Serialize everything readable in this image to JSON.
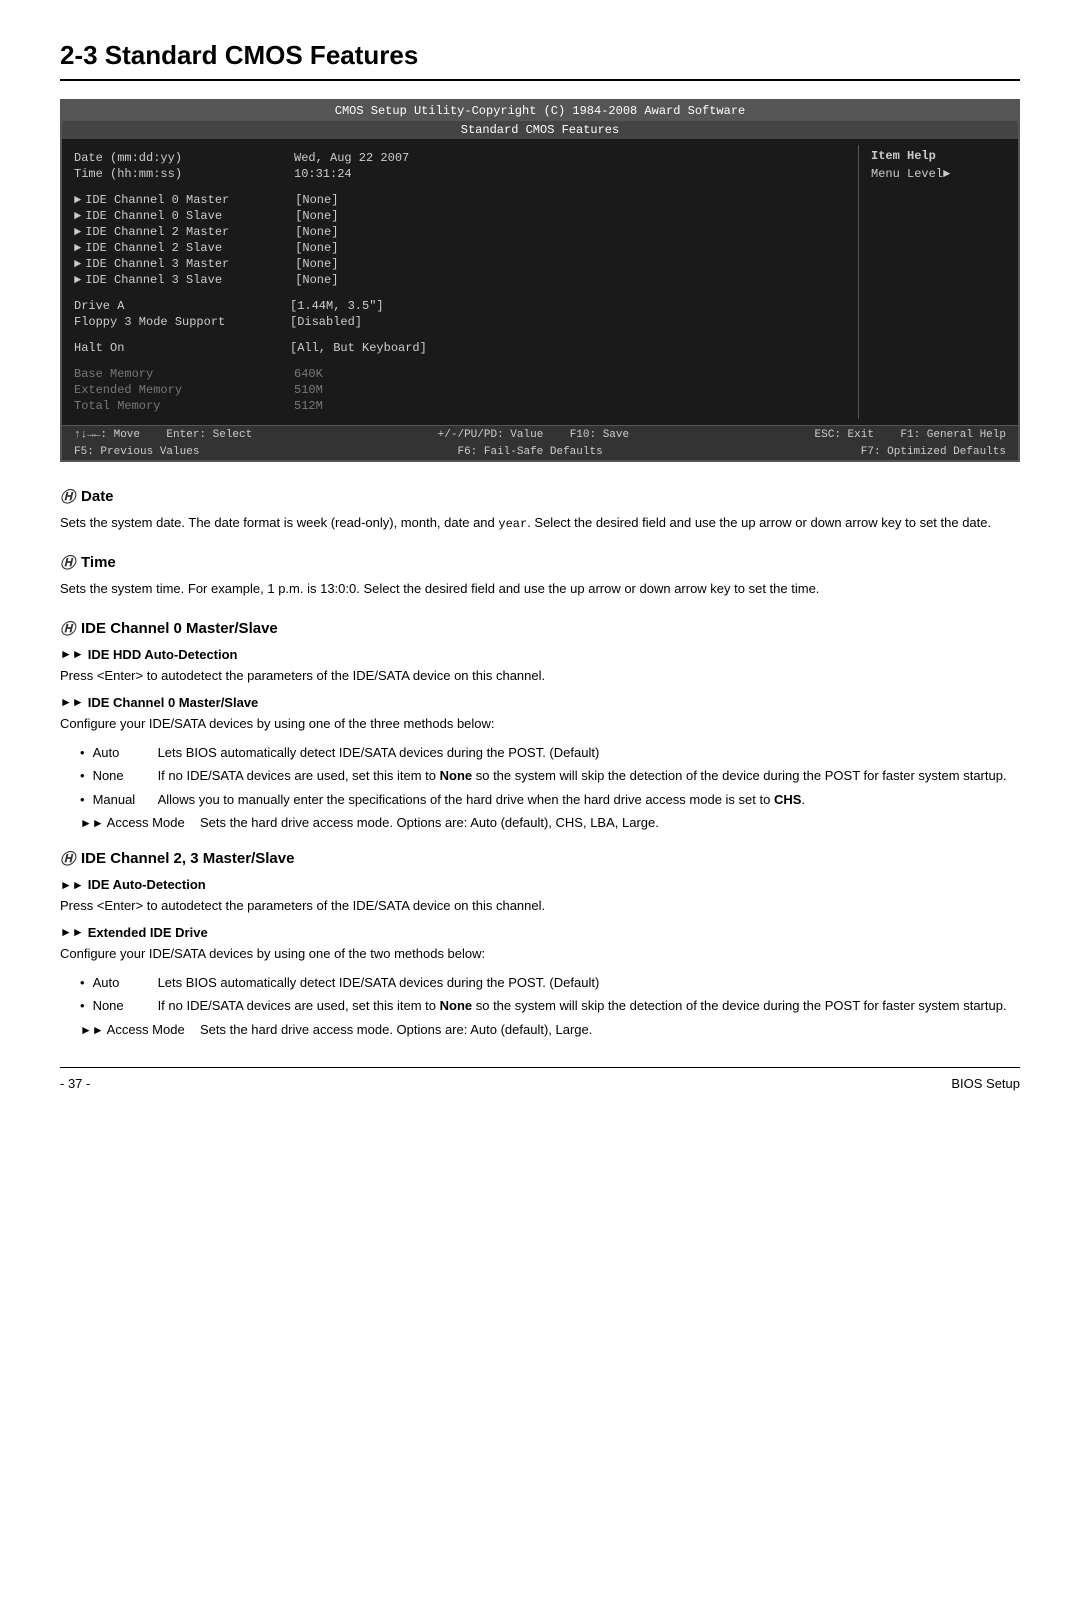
{
  "page": {
    "title": "2-3   Standard CMOS Features",
    "footer_left": "- 37 -",
    "footer_right": "BIOS Setup"
  },
  "bios": {
    "header_line1": "CMOS Setup Utility-Copyright (C) 1984-2008 Award Software",
    "header_line2": "Standard CMOS Features",
    "rows": [
      {
        "label": "Date (mm:dd:yy)",
        "value": "Wed, Aug 22  2007",
        "indent": false,
        "arrow": false,
        "gray": false
      },
      {
        "label": "Time (hh:mm:ss)",
        "value": "10:31:24",
        "indent": false,
        "arrow": false,
        "gray": false
      }
    ],
    "ide_rows": [
      {
        "label": "IDE Channel 0 Master",
        "value": "[None]"
      },
      {
        "label": "IDE Channel 0 Slave",
        "value": "[None]"
      },
      {
        "label": "IDE Channel 2 Master",
        "value": "[None]"
      },
      {
        "label": "IDE Channel 2 Slave",
        "value": "[None]"
      },
      {
        "label": "IDE Channel 3 Master",
        "value": "[None]"
      },
      {
        "label": "IDE Channel 3 Slave",
        "value": "[None]"
      }
    ],
    "drive_rows": [
      {
        "label": "Drive A",
        "value": "[1.44M, 3.5\"]"
      },
      {
        "label": "Floppy 3 Mode Support",
        "value": "[Disabled]"
      }
    ],
    "halt_row": {
      "label": "Halt On",
      "value": "[All, But Keyboard]"
    },
    "mem_rows": [
      {
        "label": "Base Memory",
        "value": "640K"
      },
      {
        "label": "Extended Memory",
        "value": "510M"
      },
      {
        "label": "Total Memory",
        "value": "512M"
      }
    ],
    "item_help_title": "Item Help",
    "item_help_text": "Menu Level►",
    "footer": [
      {
        "left": "↑↓→←: Move    Enter: Select",
        "mid": "+/-/PU/PD: Value    F10: Save",
        "right": "ESC: Exit    F1: General Help"
      },
      {
        "left": "F5: Previous Values",
        "mid": "F6: Fail-Safe Defaults",
        "right": "F7: Optimized Defaults"
      }
    ]
  },
  "sections": [
    {
      "id": "date",
      "heading": "Date",
      "paragraphs": [
        "Sets the system date. The date format is week (read-only), month, date and  year.  Select the desired field and use the up arrow or down arrow key to set the date."
      ],
      "sub_sections": []
    },
    {
      "id": "time",
      "heading": "Time",
      "paragraphs": [
        "Sets the system time. For example, 1 p.m. is 13:0:0. Select the desired field and use the up arrow or down arrow key to set the time."
      ],
      "sub_sections": []
    },
    {
      "id": "ide0",
      "heading": "IDE Channel 0 Master/Slave",
      "paragraphs": [],
      "sub_sections": [
        {
          "title": "IDE HDD Auto-Detection",
          "body": "Press <Enter> to autodetect the parameters of the IDE/SATA device on this channel."
        },
        {
          "title": "IDE Channel 0 Master/Slave",
          "body": "Configure your IDE/SATA devices by using one of the three methods below:",
          "bullets": [
            {
              "term": "Auto",
              "desc": "Lets BIOS automatically detect IDE/SATA devices during the POST. (Default)"
            },
            {
              "term": "None",
              "desc": "If no IDE/SATA devices are used, set this item to None so the system will skip the detection of the device during the POST for faster system startup."
            },
            {
              "term": "Manual",
              "desc": "Allows you to manually enter the specifications of the hard drive when the hard drive access mode is set to CHS."
            }
          ]
        },
        {
          "title": "Access Mode",
          "body": "Sets the hard drive access mode. Options are: Auto (default), CHS, LBA, Large.",
          "is_access": true
        }
      ]
    },
    {
      "id": "ide23",
      "heading": "IDE Channel 2, 3 Master/Slave",
      "paragraphs": [],
      "sub_sections": [
        {
          "title": "IDE Auto-Detection",
          "body": "Press <Enter> to autodetect the parameters of the IDE/SATA device on this channel."
        },
        {
          "title": "Extended IDE Drive",
          "body": "Configure your IDE/SATA devices by using one of the two methods below:",
          "bullets": [
            {
              "term": "Auto",
              "desc": "Lets BIOS automatically detect IDE/SATA devices during the POST. (Default)"
            },
            {
              "term": "None",
              "desc": "If no IDE/SATA devices are used, set this item to None so the system will skip the detection of the device during the POST for faster system startup."
            }
          ]
        },
        {
          "title": "Access Mode",
          "body": "Sets the hard drive access mode. Options are: Auto (default), Large.",
          "is_access": true
        }
      ]
    }
  ]
}
